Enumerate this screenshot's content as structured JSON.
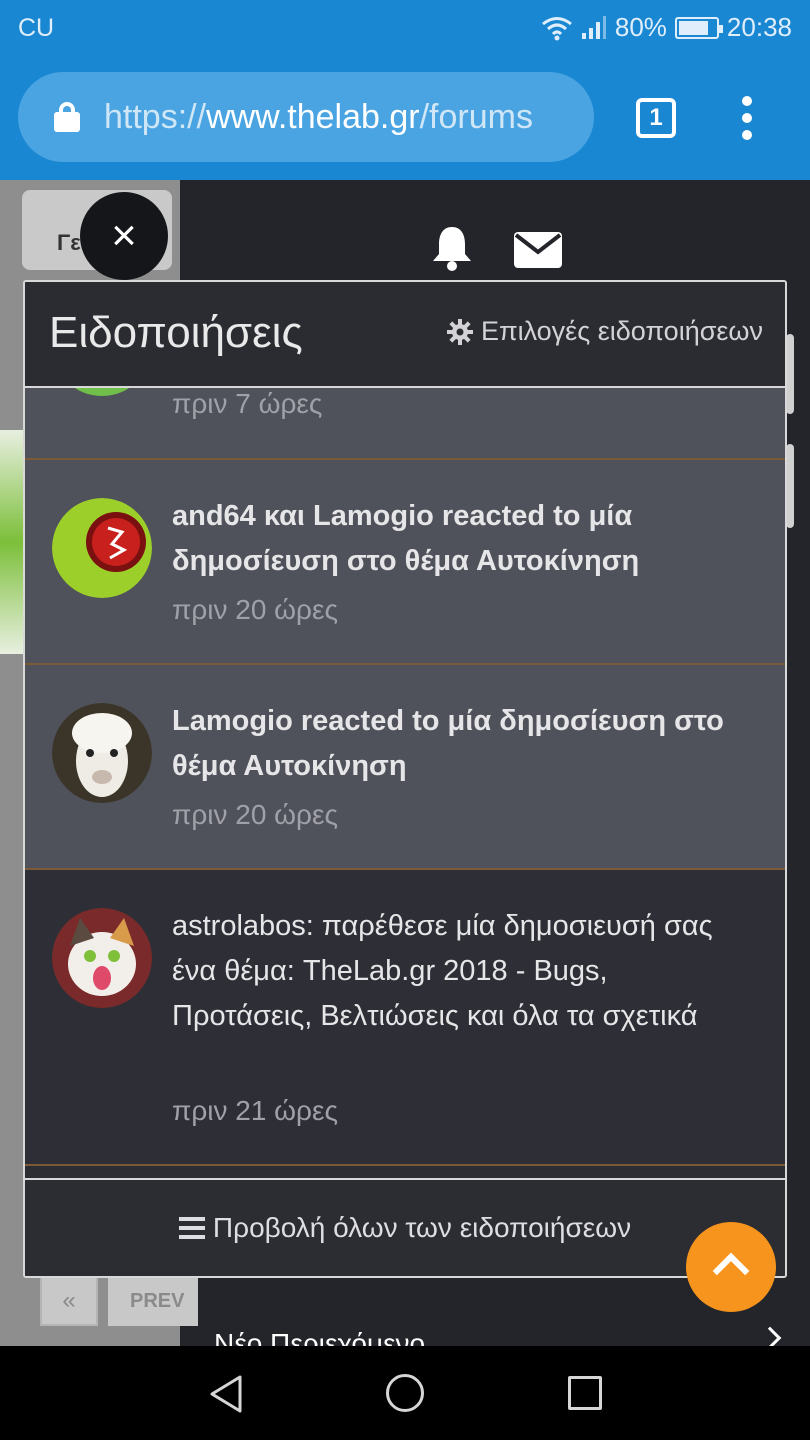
{
  "status_bar": {
    "carrier": "CU",
    "battery": "80%",
    "battery_level": 0.8,
    "time": "20:38"
  },
  "browser": {
    "url_scheme": "https://",
    "url_host": "www.thelab.gr",
    "url_path": "/forums",
    "tab_count": "1"
  },
  "background_page": {
    "left_tab_text": "Γε",
    "prev_label": "PREV",
    "prev_first_label": "«",
    "new_content_label": "Νέο Περιεχόμενο"
  },
  "close_label": "×",
  "notifications": {
    "title": "Ειδοποιήσεις",
    "options_label": "Επιλογές ειδοποιήσεων",
    "partial_item_time": "πριν 7 ώρες",
    "items": [
      {
        "text": "and64 και Lamogio reacted to μία δημοσίευση στο θέμα Αυτοκίνηση",
        "time": "πριν 20 ώρες",
        "unread": true
      },
      {
        "text": "Lamogio reacted to μία δημοσίευση στο θέμα Αυτοκίνηση",
        "time": "πριν 20 ώρες",
        "unread": true
      },
      {
        "text": "astrolabos: παρέθεσε μία δημοσιευσή σας ένα θέμα: TheLab.gr 2018 - Bugs, Προτάσεις, Βελτιώσεις και όλα τα σχετικά",
        "time": "πριν 21 ώρες",
        "unread": false
      }
    ],
    "view_all_label": "Προβολή όλων των ειδοποιήσεων"
  },
  "colors": {
    "browser_bar": "#1a87d3",
    "panel_bg": "#2c2d33",
    "unread_bg": "#50525b",
    "divider": "#7a5a37",
    "fab": "#f7941d"
  }
}
